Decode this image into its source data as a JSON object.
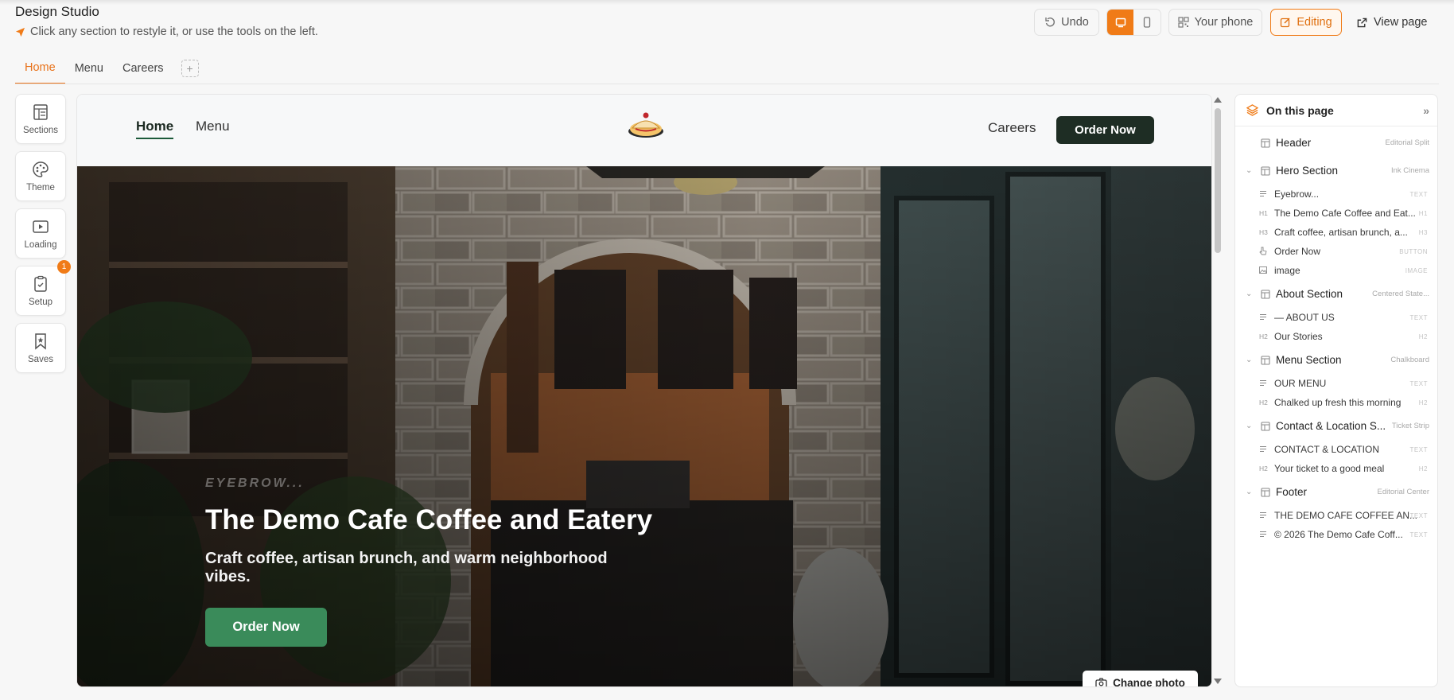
{
  "app": {
    "title": "Design Studio",
    "hint": "Click any section to restyle it, or use the tools on the left."
  },
  "toolbar": {
    "undo": "Undo",
    "your_phone": "Your phone",
    "editing": "Editing",
    "view_page": "View page"
  },
  "tabs": [
    "Home",
    "Menu",
    "Careers"
  ],
  "tools": [
    {
      "label": "Sections",
      "icon": "sections-icon"
    },
    {
      "label": "Theme",
      "icon": "palette-icon"
    },
    {
      "label": "Loading",
      "icon": "loading-icon"
    },
    {
      "label": "Setup",
      "icon": "clipboard-icon",
      "badge": "1"
    },
    {
      "label": "Saves",
      "icon": "bookmark-icon"
    }
  ],
  "site": {
    "nav": {
      "home": "Home",
      "menu": "Menu",
      "careers": "Careers",
      "order": "Order Now"
    },
    "hero": {
      "eyebrow": "EYEBROW...",
      "title": "The Demo Cafe Coffee and Eatery",
      "subtitle": "Craft coffee, artisan brunch, and warm neighborhood vibes.",
      "cta": "Order Now",
      "change_photo": "Change photo"
    }
  },
  "panel": {
    "title": "On this page",
    "sections": [
      {
        "label": "Header",
        "style": "Editorial Split",
        "collapsible": false,
        "items": []
      },
      {
        "label": "Hero Section",
        "style": "Ink Cinema",
        "collapsible": true,
        "items": [
          {
            "tag": "",
            "icon": "text-icon",
            "label": "Eyebrow...",
            "type": "TEXT"
          },
          {
            "tag": "H1",
            "icon": "",
            "label": "The Demo Cafe Coffee and Eat...",
            "type": "H1"
          },
          {
            "tag": "H3",
            "icon": "",
            "label": "Craft coffee, artisan brunch, a...",
            "type": "H3"
          },
          {
            "tag": "",
            "icon": "pointer-icon",
            "label": "Order Now",
            "type": "BUTTON"
          },
          {
            "tag": "",
            "icon": "image-icon",
            "label": "image",
            "type": "IMAGE"
          }
        ]
      },
      {
        "label": "About Section",
        "style": "Centered State...",
        "collapsible": true,
        "items": [
          {
            "tag": "",
            "icon": "text-icon",
            "label": "— ABOUT US",
            "type": "TEXT"
          },
          {
            "tag": "H2",
            "icon": "",
            "label": "Our Stories",
            "type": "H2"
          }
        ]
      },
      {
        "label": "Menu Section",
        "style": "Chalkboard",
        "collapsible": true,
        "items": [
          {
            "tag": "",
            "icon": "text-icon",
            "label": "OUR MENU",
            "type": "TEXT"
          },
          {
            "tag": "H2",
            "icon": "",
            "label": "Chalked up fresh this morning",
            "type": "H2"
          }
        ]
      },
      {
        "label": "Contact & Location S...",
        "style": "Ticket Strip",
        "collapsible": true,
        "items": [
          {
            "tag": "",
            "icon": "text-icon",
            "label": "CONTACT & LOCATION",
            "type": "TEXT"
          },
          {
            "tag": "H2",
            "icon": "",
            "label": "Your ticket to a good meal",
            "type": "H2"
          }
        ]
      },
      {
        "label": "Footer",
        "style": "Editorial Center",
        "collapsible": true,
        "items": [
          {
            "tag": "",
            "icon": "text-icon",
            "label": "THE DEMO CAFE COFFEE AN...",
            "type": "TEXT"
          },
          {
            "tag": "",
            "icon": "text-icon",
            "label": "© 2026 The Demo Cafe Coff...",
            "type": "TEXT"
          }
        ]
      }
    ]
  },
  "colors": {
    "accent": "#f07b17",
    "nav_button": "#1e2d24",
    "hero_button": "#3a8b5a"
  }
}
